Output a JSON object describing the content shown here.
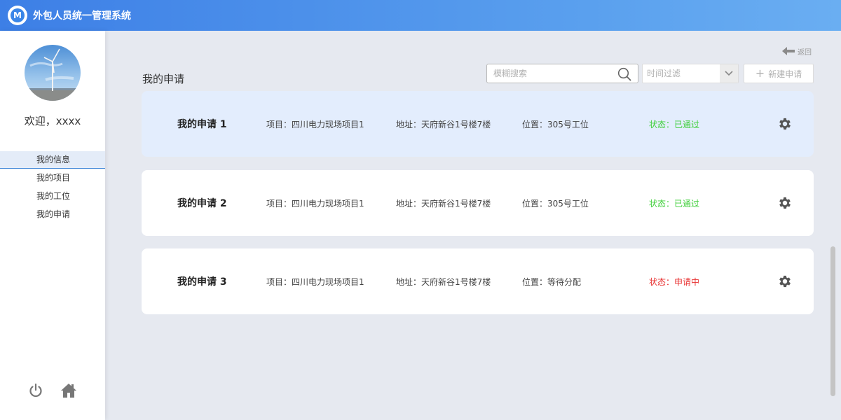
{
  "app": {
    "title": "外包人员统一管理系统",
    "logo_letter": "M"
  },
  "sidebar": {
    "welcome": "欢迎，xxxx",
    "menu": [
      {
        "label": "我的信息",
        "active": true
      },
      {
        "label": "我的项目",
        "active": false
      },
      {
        "label": "我的工位",
        "active": false
      },
      {
        "label": "我的申请",
        "active": false
      }
    ],
    "bottom_icons": [
      "power-icon",
      "home-icon"
    ]
  },
  "header": {
    "back_label": "返回",
    "page_title": "我的申请",
    "search_placeholder": "模糊搜索",
    "filter_placeholder": "时间过滤",
    "new_button": "新建申请"
  },
  "applications": [
    {
      "title": "我的申请 1",
      "project": "项目：四川电力现场项目1",
      "address": "地址：天府新谷1号楼7楼",
      "position": "位置：305号工位",
      "status": "状态：已通过",
      "status_color": "#3fcf3a",
      "highlighted": true
    },
    {
      "title": "我的申请 2",
      "project": "项目：四川电力现场项目1",
      "address": "地址：天府新谷1号楼7楼",
      "position": "位置：305号工位",
      "status": "状态：已通过",
      "status_color": "#3fcf3a",
      "highlighted": false
    },
    {
      "title": "我的申请 3",
      "project": "项目：四川电力现场项目1",
      "address": "地址：天府新谷1号楼7楼",
      "position": "位置：等待分配",
      "status": "状态：申请中",
      "status_color": "#e83030",
      "highlighted": false
    }
  ],
  "colors": {
    "topbar": "#3d7fe6",
    "accent": "#3e86d8",
    "approved": "#3fcf3a",
    "pending": "#e83030"
  }
}
